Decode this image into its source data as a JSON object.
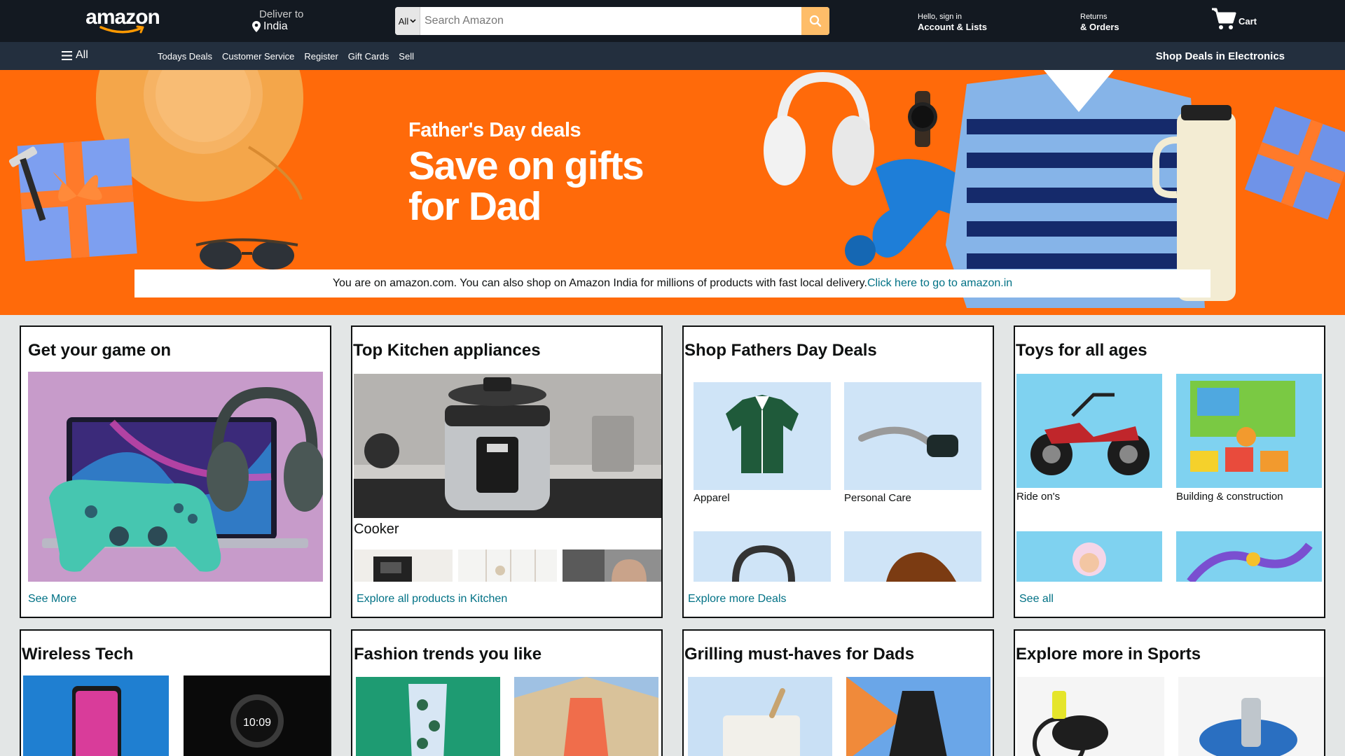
{
  "header": {
    "logo_text": "amazon",
    "deliver_label": "Deliver to",
    "deliver_location": "India",
    "search_category": "All",
    "search_placeholder": "Search Amazon",
    "account_greeting": "Hello, sign in",
    "account_label": "Account & Lists",
    "returns_small": "Returns",
    "returns_label": "& Orders",
    "cart_label": "Cart"
  },
  "subnav": {
    "all_label": "All",
    "links": [
      "Todays Deals",
      "Customer Service",
      "Register",
      "Gift Cards",
      "Sell"
    ],
    "promo": "Shop Deals in Electronics"
  },
  "hero": {
    "small": "Father's Day deals",
    "line1": "Save on gifts",
    "line2": "for Dad",
    "notice_text": "You are on amazon.com. You can also shop on Amazon India for millions of products with fast local delivery.",
    "notice_link": "Click here to go to amazon.in"
  },
  "cards": [
    {
      "title": "Get your game on",
      "link": "See More"
    },
    {
      "title": "Top Kitchen appliances",
      "caption": "Cooker",
      "link": "Explore all products in Kitchen"
    },
    {
      "title": "Shop Fathers Day Deals",
      "tiles": [
        "Apparel",
        "Personal Care"
      ],
      "link": "Explore more Deals"
    },
    {
      "title": "Toys for all ages",
      "tiles": [
        "Ride on's",
        "Building & construction"
      ],
      "link": "See all"
    },
    {
      "title": "Wireless Tech"
    },
    {
      "title": "Fashion trends you like"
    },
    {
      "title": "Grilling must-haves for Dads"
    },
    {
      "title": "Explore more in Sports"
    }
  ],
  "colors": {
    "nav_dark": "#131921",
    "nav_sub": "#232f3e",
    "hero_orange": "#ff6a0a",
    "search_button": "#febd69",
    "link": "#007185"
  },
  "icons": [
    "location-pin-icon",
    "search-icon",
    "cart-icon",
    "hamburger-menu-icon",
    "chevron-down-icon"
  ]
}
